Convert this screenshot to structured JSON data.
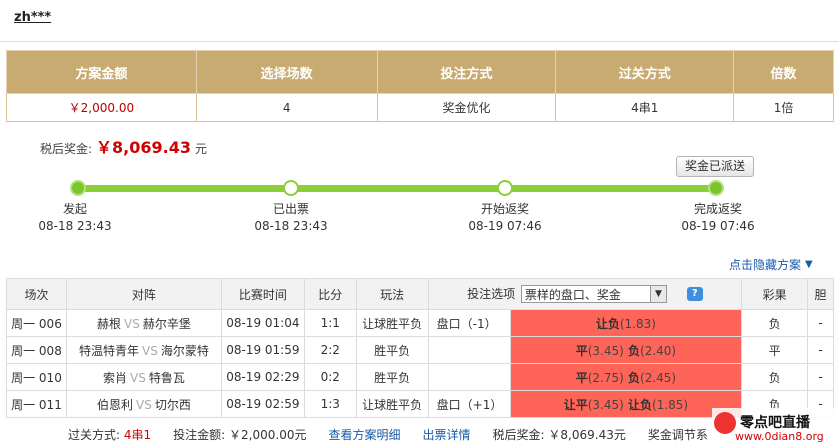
{
  "user": {
    "name": "zh***"
  },
  "summary": {
    "headers": [
      "方案金额",
      "选择场数",
      "投注方式",
      "过关方式",
      "倍数"
    ],
    "values": [
      "￥2,000.00",
      "4",
      "奖金优化",
      "4串1",
      "1倍"
    ]
  },
  "prize": {
    "label": "税后奖金:",
    "amount": "￥8,069.43",
    "unit": "元"
  },
  "distributed_button": "奖金已派送",
  "progress": {
    "steps": [
      {
        "label": "发起",
        "time": "08-18 23:43"
      },
      {
        "label": "已出票",
        "time": "08-18 23:43"
      },
      {
        "label": "开始返奖",
        "time": "08-19 07:46"
      },
      {
        "label": "完成返奖",
        "time": "08-19 07:46"
      }
    ]
  },
  "hidden_plan_link": "点击隐藏方案",
  "matches": {
    "headers": {
      "session": "场次",
      "teams": "对阵",
      "time": "比赛时间",
      "score": "比分",
      "play": "玩法",
      "bet_option": "投注选项",
      "select_value": "票样的盘口、奖金",
      "result": "彩果",
      "extra": "胆"
    },
    "vs_text": "VS",
    "rows": [
      {
        "session": "周一 006",
        "home": "赫根",
        "away": "赫尔辛堡",
        "time": "08-19 01:04",
        "score": "1:1",
        "play": "让球胜平负",
        "handicap": "盘口（-1）",
        "picks": [
          {
            "name": "让负",
            "odd": "(1.83)"
          }
        ],
        "result": "负",
        "extra": "-"
      },
      {
        "session": "周一 008",
        "home": "特温特青年",
        "away": "海尔蒙特",
        "time": "08-19 01:59",
        "score": "2:2",
        "play": "胜平负",
        "handicap": "",
        "picks": [
          {
            "name": "平",
            "odd": "(3.45)"
          },
          {
            "name": "负",
            "odd": "(2.40)"
          }
        ],
        "result": "平",
        "extra": "-"
      },
      {
        "session": "周一 010",
        "home": "索肖",
        "away": "特鲁瓦",
        "time": "08-19 02:29",
        "score": "0:2",
        "play": "胜平负",
        "handicap": "",
        "picks": [
          {
            "name": "平",
            "odd": "(2.75)"
          },
          {
            "name": "负",
            "odd": "(2.45)"
          }
        ],
        "result": "负",
        "extra": "-"
      },
      {
        "session": "周一 011",
        "home": "伯恩利",
        "away": "切尔西",
        "time": "08-19 02:59",
        "score": "1:3",
        "play": "让球胜平负",
        "handicap": "盘口（+1）",
        "picks": [
          {
            "name": "让平",
            "odd": "(3.45)"
          },
          {
            "name": "让负",
            "odd": "(1.85)"
          }
        ],
        "result": "负",
        "extra": "-"
      }
    ]
  },
  "footer": {
    "pass_label": "过关方式:",
    "pass_value": "4串1",
    "bet_amount_label": "投注金额:",
    "bet_amount_value": "￥2,000.00",
    "bet_amount_unit": "元",
    "view_detail": "查看方案明细",
    "ticket_detail": "出票详情",
    "after_tax_label": "税后奖金:",
    "after_tax_value": "￥8,069.43",
    "after_tax_unit": "元",
    "adjust_label": "奖金调节系"
  },
  "watermark": {
    "line1": "零点吧直播",
    "line2": "www.0dian8.org"
  },
  "colors": {
    "gold": "#c8ab71",
    "green": "#8ccf3a",
    "hit": "#fe6457",
    "link": "#1a5aa8",
    "red": "#d10000"
  }
}
